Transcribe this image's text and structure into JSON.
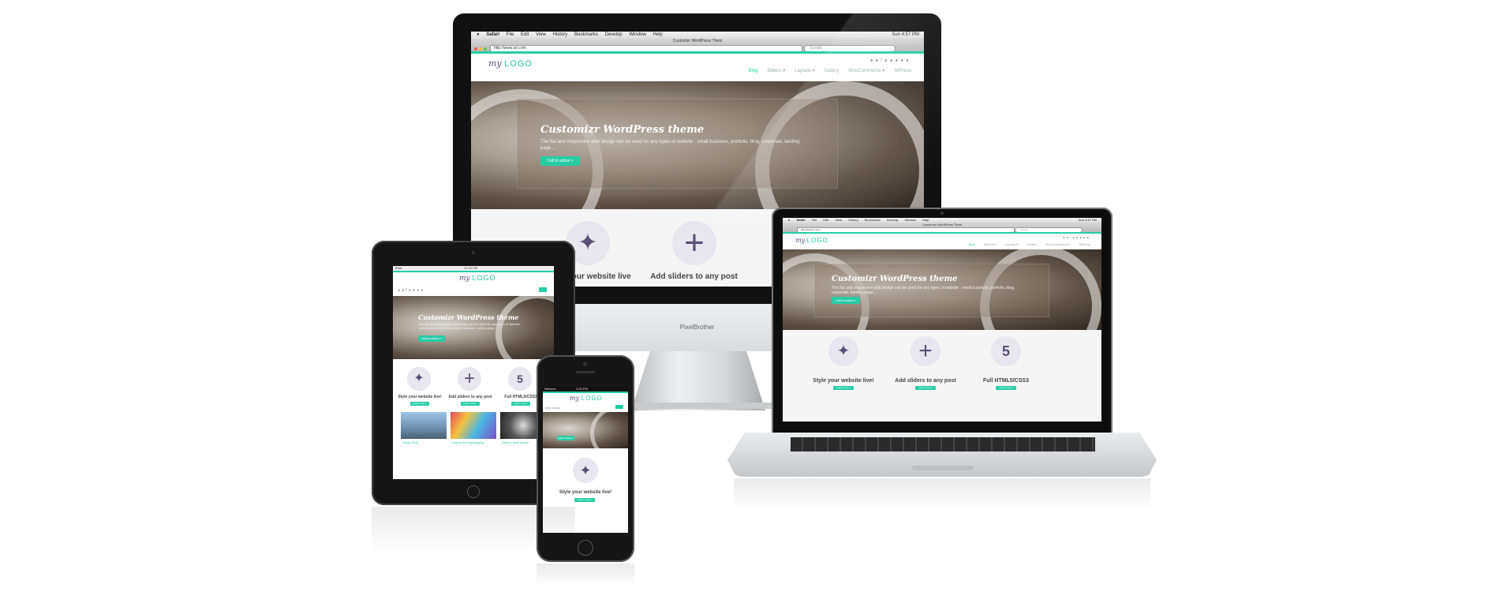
{
  "desktop": {
    "menubar": {
      "apple": "",
      "items": [
        "Safari",
        "File",
        "Edit",
        "View",
        "History",
        "Bookmarks",
        "Develop",
        "Window",
        "Help"
      ],
      "status": "Sun 4:57 PM"
    },
    "browser": {
      "title": "Customizr WordPress Them",
      "url": "http://www.url.com",
      "search_placeholder": "Google"
    },
    "site": {
      "logo_prefix": "my",
      "logo_word": "LOGO",
      "nav": [
        "Blog",
        "Sliders ▾",
        "Layouts ▾",
        "Gallery",
        "WooCommerce ▾",
        "SliPress"
      ],
      "hero_title": "Customizr WordPress theme",
      "hero_text": "The flat and responsive web design can be used for any types of website : small business, portfolio, blog, corporate, landing page...",
      "cta": "Call to action »",
      "features": [
        {
          "icon": "magic-wand-icon",
          "title": "Style your website live!",
          "button": "Learn more »"
        },
        {
          "icon": "plus-icon",
          "title": "Add sliders to any post",
          "button": "Learn more »"
        },
        {
          "icon": "html5-icon",
          "title": "Full HTML5/CSS3",
          "button": "Learn more »"
        }
      ],
      "thumbs": [
        "Sticky Post",
        "Layout and typography",
        "Gallery post format"
      ]
    },
    "brand": "PixelBrother"
  },
  "tablet": {
    "status_left": "iPad",
    "status_time": "12:15 PM"
  },
  "phone": {
    "status_left": "Network",
    "status_time": "4:53 PM"
  },
  "colors": {
    "accent": "#27cda5",
    "logo": "#5a4a7a",
    "icon": "#5a4f75"
  }
}
